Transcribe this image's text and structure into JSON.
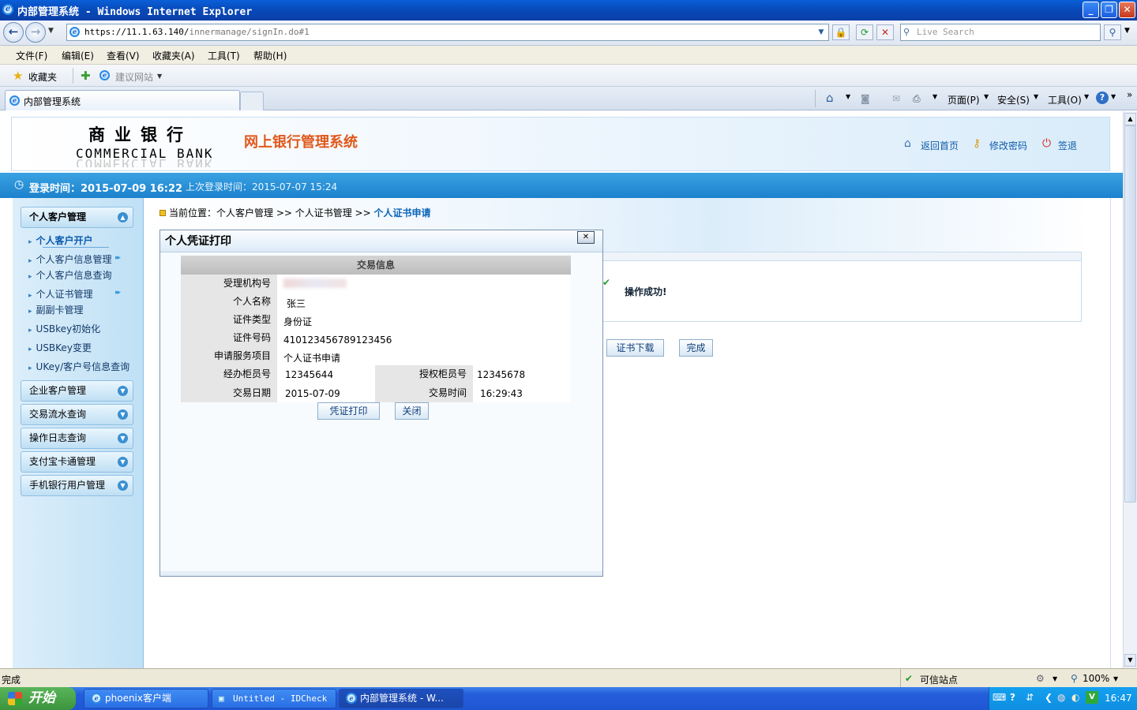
{
  "window": {
    "title": "内部管理系统 - Windows Internet Explorer"
  },
  "browser": {
    "url_host": "https://11.1.63.140/",
    "url_path": "innermanage/signIn.do#1",
    "search_placeholder": "Live Search",
    "menu": [
      "文件(F)",
      "编辑(E)",
      "查看(V)",
      "收藏夹(A)",
      "工具(T)",
      "帮助(H)"
    ],
    "favorites_label": "收藏夹",
    "suggested_sites": "建议网站",
    "tab_title": "内部管理系统",
    "cmd_page": "页面(P)",
    "cmd_safety": "安全(S)",
    "cmd_tools": "工具(O)"
  },
  "header": {
    "logo_cn": "商业银行",
    "logo_en": "COMMERCIAL BANK",
    "system_title": "网上银行管理系统",
    "links": {
      "home": "返回首页",
      "password": "修改密码",
      "logout": "签退"
    }
  },
  "login_bar": {
    "login_time": "登录时间：2015-07-09 16:22",
    "last_login": "上次登录时间：2015-07-07 15:24"
  },
  "sidebar": {
    "personal": "个人客户管理",
    "items": [
      "个人客户开户",
      "个人客户信息管理",
      "个人客户信息查询",
      "个人证书管理",
      "副副卡管理",
      "USBkey初始化",
      "USBKey变更",
      "UKey/客户号信息查询"
    ],
    "sections": [
      "企业客户管理",
      "交易流水查询",
      "操作日志查询",
      "支付宝卡通管理",
      "手机银行用户管理"
    ]
  },
  "breadcrumb": {
    "prefix": "当前位置：个人客户管理 >> 个人证书管理 >> ",
    "current": "个人证书申请"
  },
  "result": {
    "message": "操作成功!",
    "download_button": "证书下载",
    "finish_button": "完成"
  },
  "modal": {
    "title": "个人凭证打印",
    "section_header": "交易信息",
    "fields": {
      "org_label": "受理机构号",
      "org_value": "",
      "name_label": "个人名称",
      "name_value": "张三",
      "id_type_label": "证件类型",
      "id_type_value": "身份证",
      "id_no_label": "证件号码",
      "id_no_value": "410123456789123456",
      "service_label": "申请服务项目",
      "service_value": "个人证书申请",
      "teller_label": "经办柜员号",
      "teller_value": "12345644",
      "auth_teller_label": "授权柜员号",
      "auth_teller_value": "12345678",
      "date_label": "交易日期",
      "date_value": "2015-07-09",
      "time_label": "交易时间",
      "time_value": "16:29:43"
    },
    "print_button": "凭证打印",
    "close_button": "关闭"
  },
  "status": {
    "text": "完成",
    "zone": "可信站点",
    "zoom": "100%"
  },
  "taskbar": {
    "start": "开始",
    "tasks": [
      "phoenix客户端",
      "Untitled - IDCheck",
      "内部管理系统 - W..."
    ],
    "clock": "16:47"
  }
}
